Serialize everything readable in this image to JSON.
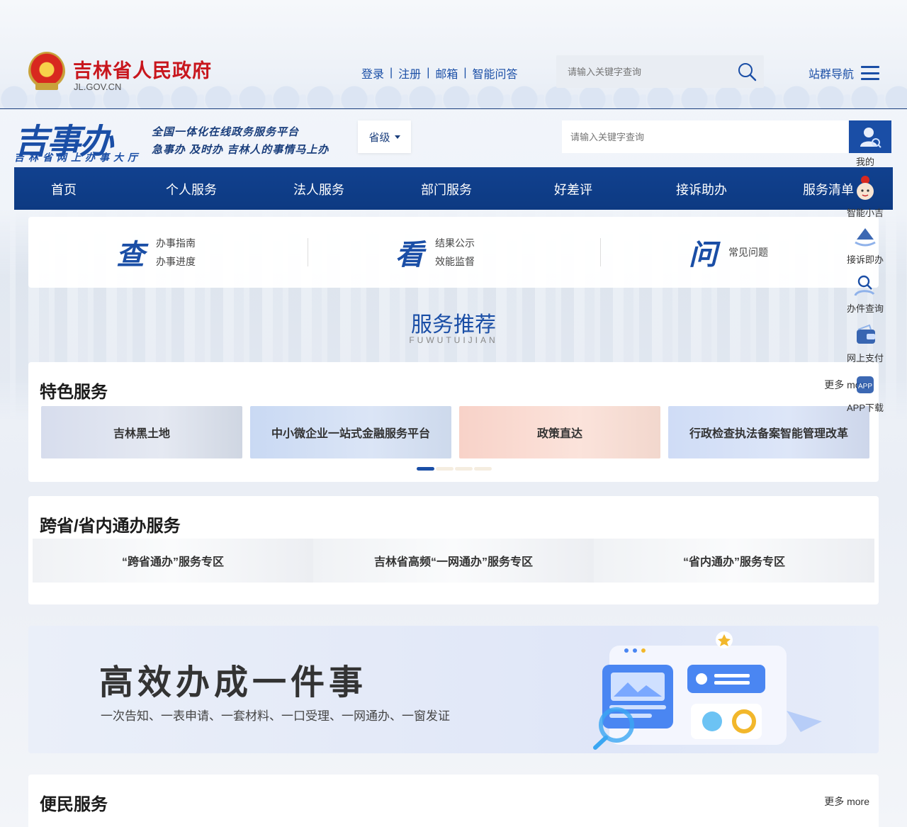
{
  "gov": {
    "title": "吉林省人民政府",
    "domain": "JL.GOV.CN"
  },
  "top_links": [
    "登录",
    "注册",
    "邮箱",
    "智能问答"
  ],
  "top_search": {
    "placeholder": "请输入关键字查询"
  },
  "site_nav": {
    "label": "站群导航"
  },
  "jsb": {
    "logo": "吉事办",
    "sub": "吉林省网上办事大厅",
    "slogan1": "全国一体化在线政务服务平台",
    "slogan2": "急事办 及时办 吉林人的事情马上办"
  },
  "level": {
    "label": "省级"
  },
  "main_search": {
    "placeholder": "请输入关键字查询"
  },
  "nav": [
    "首页",
    "个人服务",
    "法人服务",
    "部门服务",
    "好差评",
    "接诉助办",
    "服务清单"
  ],
  "quick": [
    {
      "big": "查",
      "items": [
        "办事指南",
        "办事进度"
      ]
    },
    {
      "big": "看",
      "items": [
        "结果公示",
        "效能监督"
      ]
    },
    {
      "big": "问",
      "items": [
        "常见问题"
      ]
    }
  ],
  "recommend": {
    "title": "服务推荐",
    "sub": "FUWUTUIJIAN"
  },
  "featured": {
    "title": "特色服务",
    "more": "更多 more",
    "tiles": [
      "吉林黑土地",
      "中小微企业一站式金融服务平台",
      "政策直达",
      "行政检查执法备案智能管理改革"
    ]
  },
  "cross": {
    "title": "跨省/省内通办服务",
    "zones": [
      "“跨省通办”服务专区",
      "吉林省高频“一网通办”服务专区",
      "“省内通办”服务专区"
    ]
  },
  "banner": {
    "title": "高效办成一件事",
    "desc": "一次告知、一表申请、一套材料、一口受理、一网通办、一窗发证"
  },
  "convenience": {
    "title": "便民服务",
    "more": "更多 more"
  },
  "side_tools": [
    "我的",
    "智能小吉",
    "接诉即办",
    "办件查询",
    "网上支付",
    "APP下载"
  ],
  "colors": {
    "primary": "#1a4ea6",
    "nav": "#0d3a82",
    "gov_red": "#c8161d"
  }
}
